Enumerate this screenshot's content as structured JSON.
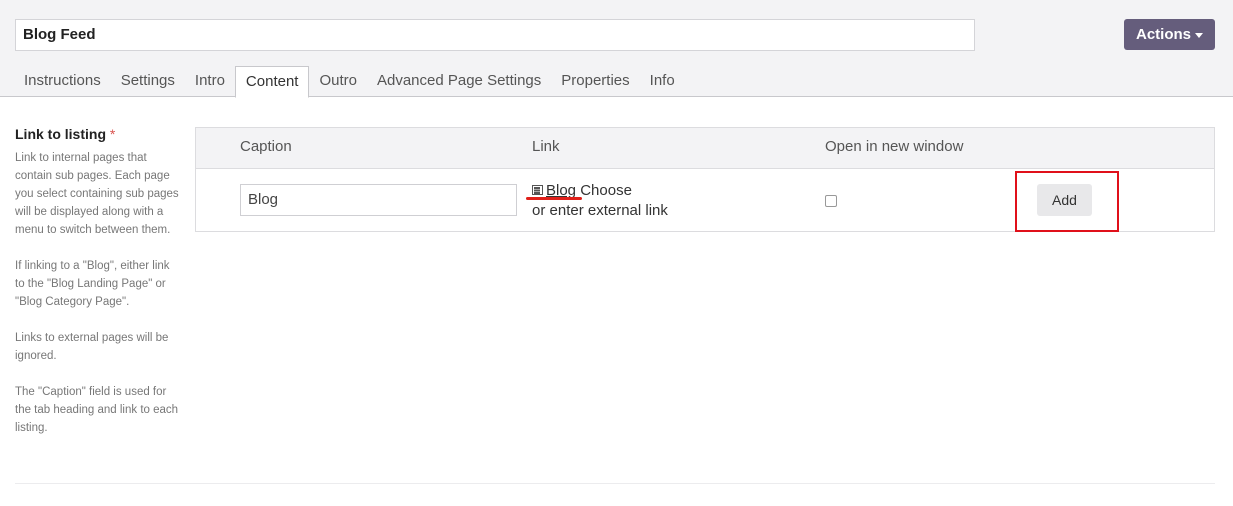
{
  "header": {
    "title_value": "Blog Feed",
    "actions_label": "Actions"
  },
  "tabs": [
    {
      "label": "Instructions"
    },
    {
      "label": "Settings"
    },
    {
      "label": "Intro"
    },
    {
      "label": "Content",
      "active": true
    },
    {
      "label": "Outro"
    },
    {
      "label": "Advanced Page Settings"
    },
    {
      "label": "Properties"
    },
    {
      "label": "Info"
    }
  ],
  "field": {
    "label": "Link to listing",
    "required_mark": "*",
    "help": [
      "Link to internal pages that contain sub pages. Each page you select containing sub pages will be displayed along with a menu to switch between them.",
      "If linking to a \"Blog\", either link to the \"Blog Landing Page\" or \"Blog Category Page\".",
      "Links to external pages will be ignored.",
      "The \"Caption\" field is used for the tab heading and link to each listing."
    ]
  },
  "table": {
    "headers": {
      "caption": "Caption",
      "link": "Link",
      "new_window": "Open in new window"
    },
    "row": {
      "caption_value": "Blog",
      "link_page": "Blog",
      "choose_label": "Choose",
      "external_label": "or enter external link",
      "new_window_checked": false,
      "add_label": "Add"
    }
  },
  "colors": {
    "accent": "#655d7c",
    "highlight": "#e0101a"
  }
}
